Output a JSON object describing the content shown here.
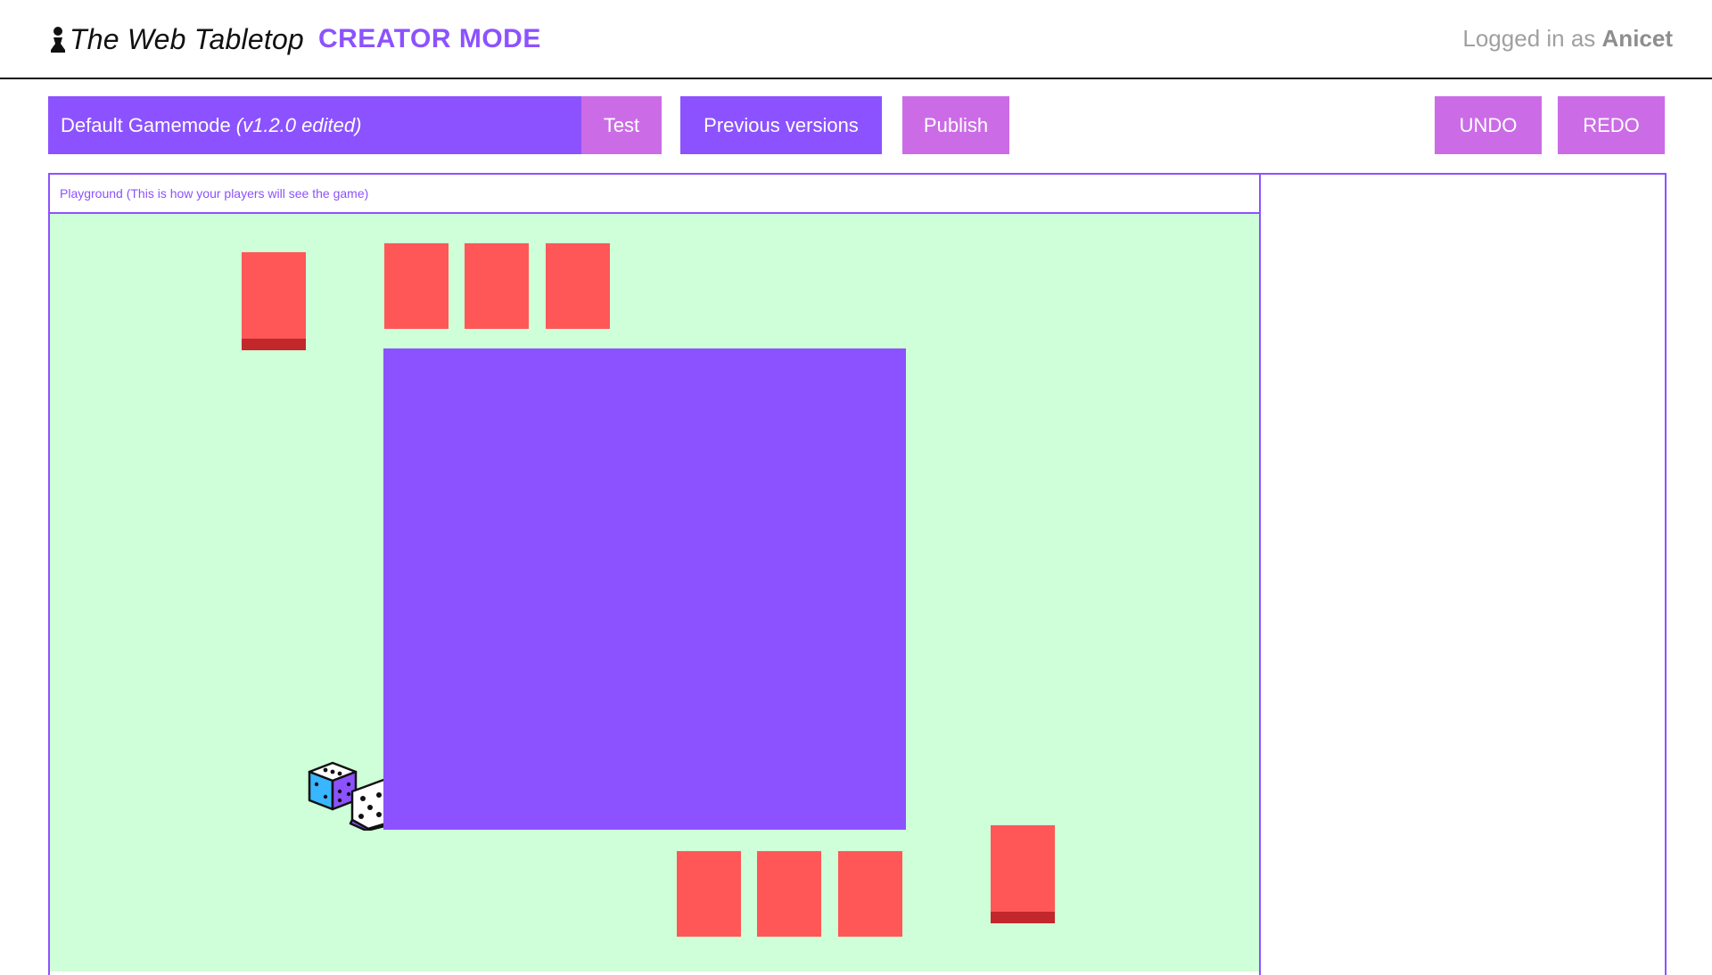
{
  "header": {
    "app_title": "The Web Tabletop",
    "mode_label": "CREATOR MODE",
    "login_prefix": "Logged in as",
    "username": "Anicet",
    "logo_icon": "pawn-icon"
  },
  "toolbar": {
    "gamemode_name": "Default Gamemode",
    "gamemode_version": "(v1.2.0 edited)",
    "test_label": "Test",
    "previous_versions_label": "Previous versions",
    "publish_label": "Publish",
    "undo_label": "UNDO",
    "redo_label": "REDO"
  },
  "playground": {
    "label": "Playground (This is how your players will see the game)",
    "board_icon": "board",
    "dice_icon": "dice-pair-icon",
    "top_cards": 3,
    "bottom_cards": 3,
    "decks": 2
  },
  "colors": {
    "accent": "#8c52ff",
    "secondary": "#cb6ce6",
    "playground_bg": "#ceffd8",
    "card": "#ff5757",
    "deck_base": "#c2282b"
  }
}
